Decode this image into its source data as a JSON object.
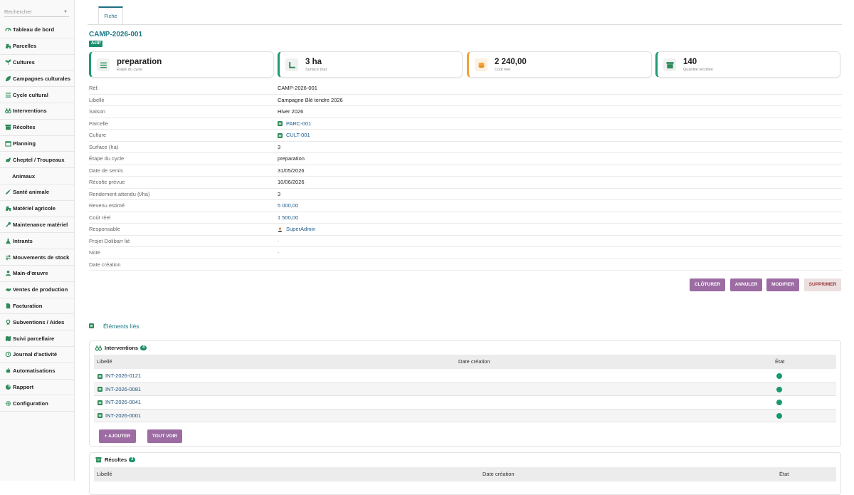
{
  "search": {
    "placeholder": "Rechercher"
  },
  "sidebar": {
    "items": [
      {
        "label": "Tableau de bord",
        "icon": "dashboard-icon"
      },
      {
        "label": "Parcelles",
        "icon": "tractor-icon"
      },
      {
        "label": "Cultures",
        "icon": "seedling-icon"
      },
      {
        "label": "Campagnes culturales",
        "icon": "leaf-icon"
      },
      {
        "label": "Cycle cultural",
        "icon": "list-icon"
      },
      {
        "label": "Interventions",
        "icon": "binoculars-icon"
      },
      {
        "label": "Récoltes",
        "icon": "archive-icon"
      },
      {
        "label": "Planning",
        "icon": "calendar-icon"
      },
      {
        "label": "Cheptel / Troupeaux",
        "icon": "horse-icon"
      },
      {
        "label": "Animaux",
        "icon": ""
      },
      {
        "label": "Santé animale",
        "icon": "syringe-icon"
      },
      {
        "label": "Matériel agricole",
        "icon": "tractor-icon"
      },
      {
        "label": "Maintenance matériel",
        "icon": "wrench-icon"
      },
      {
        "label": "Intrants",
        "icon": "flask-icon"
      },
      {
        "label": "Mouvements de stock",
        "icon": "exchange-icon"
      },
      {
        "label": "Main-d'œuvre",
        "icon": "user-icon"
      },
      {
        "label": "Ventes de production",
        "icon": "handshake-icon"
      },
      {
        "label": "Facturation",
        "icon": "file-icon"
      },
      {
        "label": "Subventions / Aides",
        "icon": "award-icon"
      },
      {
        "label": "Suivi parcellaire",
        "icon": "map-icon"
      },
      {
        "label": "Journal d'activité",
        "icon": "history-icon"
      },
      {
        "label": "Automatisations",
        "icon": "robot-icon"
      },
      {
        "label": "Rapport",
        "icon": "chart-icon"
      },
      {
        "label": "Configuration",
        "icon": "gear-icon"
      }
    ]
  },
  "tabs": {
    "fiche": "Fiche"
  },
  "record": {
    "ref": "CAMP-2026-001",
    "status": "Actif"
  },
  "kpis": [
    {
      "value": "preparation",
      "label": "Étape du cycle",
      "icon": "list-icon",
      "accent": "#1e9a74"
    },
    {
      "value": "3 ha",
      "label": "Surface (ha)",
      "icon": "ruler-icon",
      "accent": "#1e9a74"
    },
    {
      "value": "2 240,00",
      "label": "Coût réel",
      "icon": "coins-icon",
      "accent": "#f2a33a"
    },
    {
      "value": "140",
      "label": "Quantité récoltée",
      "icon": "archive-icon",
      "accent": "#1e9a74"
    }
  ],
  "fields": [
    {
      "key": "Réf.",
      "value": "CAMP-2026-001",
      "kind": "text"
    },
    {
      "key": "Libellé",
      "value": "Campagne Blé tendre 2026",
      "kind": "text"
    },
    {
      "key": "Saison",
      "value": "Hiver 2026",
      "kind": "text"
    },
    {
      "key": "Parcelle",
      "value": "PARC-001",
      "kind": "link"
    },
    {
      "key": "Culture",
      "value": "CULT-001",
      "kind": "link"
    },
    {
      "key": "Surface (ha)",
      "value": "3",
      "kind": "text"
    },
    {
      "key": "Étape du cycle",
      "value": "preparation",
      "kind": "text"
    },
    {
      "key": "Date de semis",
      "value": "31/05/2026",
      "kind": "text"
    },
    {
      "key": "Récolte prévue",
      "value": "10/06/2026",
      "kind": "text"
    },
    {
      "key": "Rendement attendu (t/ha)",
      "value": "3",
      "kind": "text"
    },
    {
      "key": "Revenu estimé",
      "value": "5 000,00",
      "kind": "amount"
    },
    {
      "key": "Coût réel",
      "value": "1 500,00",
      "kind": "amount"
    },
    {
      "key": "Responsable",
      "value": "SuperAdmin",
      "kind": "user"
    },
    {
      "key": "Projet Dolibarr lié",
      "value": "-",
      "kind": "dim"
    },
    {
      "key": "Note",
      "value": "-",
      "kind": "dim"
    },
    {
      "key": "Date création",
      "value": "",
      "kind": "text"
    }
  ],
  "actions": {
    "close": "CLÔTURER",
    "cancel": "ANNULER",
    "edit": "MODIFIER",
    "delete": "SUPPRIMER"
  },
  "linked": {
    "title": "Éléments liés",
    "interventions": {
      "title": "Interventions",
      "count": "4",
      "columns": {
        "label": "Libellé",
        "date": "Date création",
        "state": "État"
      },
      "rows": [
        "INT-2026-0121",
        "INT-2026-0081",
        "INT-2026-0041",
        "INT-2026-0001"
      ],
      "add": "AJOUTER",
      "all": "TOUT VOIR"
    },
    "recoltes": {
      "title": "Récoltes",
      "count": "2",
      "columns": {
        "label": "Libellé",
        "date": "Date création",
        "state": "État"
      }
    }
  },
  "colors": {
    "accent": "#1c7a8a",
    "brand": "#9c6ca3",
    "success": "#1a8f6c",
    "warning": "#f2a33a"
  }
}
